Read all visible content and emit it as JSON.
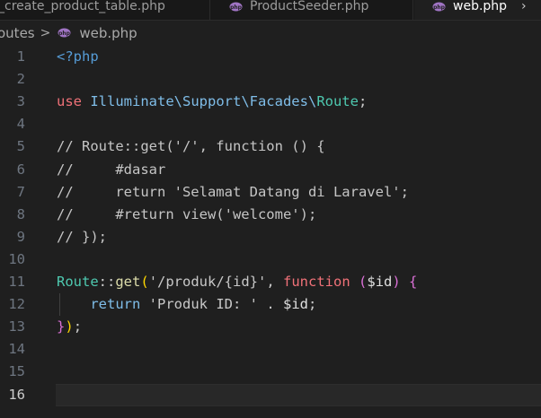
{
  "tabs": [
    {
      "label": "_create_product_table.php",
      "icon": "php-icon",
      "active": false
    },
    {
      "label": "ProductSeeder.php",
      "icon": "php-icon",
      "active": false
    },
    {
      "label": "web.php",
      "icon": "php-icon",
      "active": true,
      "suffix": "›"
    }
  ],
  "breadcrumb": {
    "folder": "outes",
    "separator": ">",
    "file": "web.php",
    "file_icon": "php-icon"
  },
  "editor": {
    "active_line": "16",
    "lines": [
      {
        "num": "1",
        "tokens": [
          {
            "t": "<?php",
            "c": "tag"
          }
        ]
      },
      {
        "num": "2",
        "tokens": []
      },
      {
        "num": "3",
        "tokens": [
          {
            "t": "use",
            "c": "kw"
          },
          {
            "t": " ",
            "c": "punc"
          },
          {
            "t": "Illuminate\\Support\\Facades\\",
            "c": "ns"
          },
          {
            "t": "Route",
            "c": "cls"
          },
          {
            "t": ";",
            "c": "punc"
          }
        ]
      },
      {
        "num": "4",
        "tokens": []
      },
      {
        "num": "5",
        "tokens": [
          {
            "t": "// Route::get('/', function () {",
            "c": "cm"
          }
        ]
      },
      {
        "num": "6",
        "tokens": [
          {
            "t": "//     #dasar",
            "c": "cm"
          }
        ]
      },
      {
        "num": "7",
        "tokens": [
          {
            "t": "//     return 'Selamat Datang di Laravel';",
            "c": "cm"
          }
        ]
      },
      {
        "num": "8",
        "tokens": [
          {
            "t": "//     #return view('welcome');",
            "c": "cm"
          }
        ]
      },
      {
        "num": "9",
        "tokens": [
          {
            "t": "// });",
            "c": "cm"
          }
        ]
      },
      {
        "num": "10",
        "tokens": []
      },
      {
        "num": "11",
        "tokens": [
          {
            "t": "Route",
            "c": "cls"
          },
          {
            "t": "::",
            "c": "punc"
          },
          {
            "t": "get",
            "c": "fn"
          },
          {
            "t": "(",
            "c": "brk"
          },
          {
            "t": "'/produk/{id}'",
            "c": "str"
          },
          {
            "t": ", ",
            "c": "punc"
          },
          {
            "t": "function",
            "c": "kw"
          },
          {
            "t": " ",
            "c": "punc"
          },
          {
            "t": "(",
            "c": "brk2"
          },
          {
            "t": "$id",
            "c": "var"
          },
          {
            "t": ")",
            "c": "brk2"
          },
          {
            "t": " ",
            "c": "punc"
          },
          {
            "t": "{",
            "c": "brk2"
          }
        ]
      },
      {
        "num": "12",
        "tokens": [
          {
            "t": "    ",
            "c": "punc"
          },
          {
            "t": "return",
            "c": "ns"
          },
          {
            "t": " ",
            "c": "punc"
          },
          {
            "t": "'Produk ID: '",
            "c": "str"
          },
          {
            "t": " . ",
            "c": "punc"
          },
          {
            "t": "$id",
            "c": "var"
          },
          {
            "t": ";",
            "c": "punc"
          }
        ]
      },
      {
        "num": "13",
        "tokens": [
          {
            "t": "}",
            "c": "brk2"
          },
          {
            "t": ")",
            "c": "brk"
          },
          {
            "t": ";",
            "c": "punc"
          }
        ]
      },
      {
        "num": "14",
        "tokens": []
      },
      {
        "num": "15",
        "tokens": []
      },
      {
        "num": "16",
        "tokens": []
      }
    ]
  },
  "colors": {
    "background": "#1f1f1f",
    "current_line": "#282828",
    "line_number": "#6e7681",
    "line_number_active": "#cccccc"
  }
}
